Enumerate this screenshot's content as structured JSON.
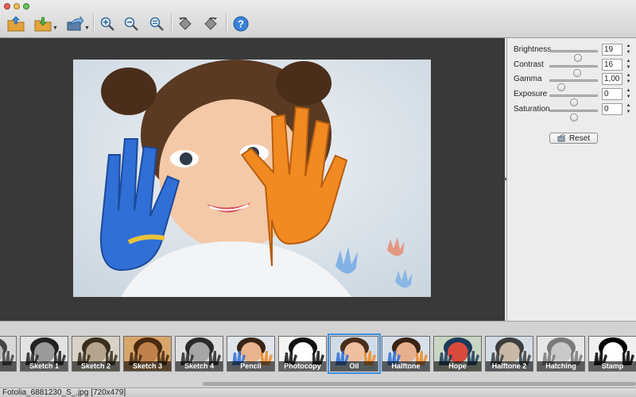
{
  "toolbar": {
    "buttons": [
      {
        "id": "open",
        "icon": "folder-open-icon"
      },
      {
        "id": "save",
        "icon": "folder-save-icon"
      },
      {
        "id": "share",
        "icon": "share-icon"
      },
      {
        "id": "zoom-in",
        "icon": "zoom-in-icon"
      },
      {
        "id": "zoom-out",
        "icon": "zoom-out-icon"
      },
      {
        "id": "zoom-fit",
        "icon": "zoom-fit-icon"
      },
      {
        "id": "rotate-left",
        "icon": "rotate-left-icon"
      },
      {
        "id": "rotate-right",
        "icon": "rotate-right-icon"
      },
      {
        "id": "help",
        "icon": "help-icon"
      }
    ]
  },
  "adjustments": {
    "brightness": {
      "label": "Brightness",
      "value": "19",
      "level": 0.6
    },
    "contrast": {
      "label": "Contrast",
      "value": "16",
      "level": 0.58
    },
    "gamma": {
      "label": "Gamma",
      "value": "1,00",
      "level": 0.2
    },
    "exposure": {
      "label": "Exposure",
      "value": "0",
      "level": 0.5
    },
    "saturation": {
      "label": "Saturation",
      "value": "0",
      "level": 0.5
    },
    "reset_label": "Reset"
  },
  "filters": {
    "items": [
      "",
      "Sketch 1",
      "Sketch 2",
      "Sketch 3",
      "Sketch 4",
      "Pencil",
      "Photocopy",
      "Oil",
      "Halftone",
      "Hope",
      "Halftone 2",
      "Hatching",
      "Stamp"
    ],
    "selected": "Oil"
  },
  "status": {
    "text": "Fotolia_6881230_S_.jpg [720x479]"
  },
  "colors": {
    "selection": "#3d8fe0",
    "canvas_bg": "#393939"
  }
}
